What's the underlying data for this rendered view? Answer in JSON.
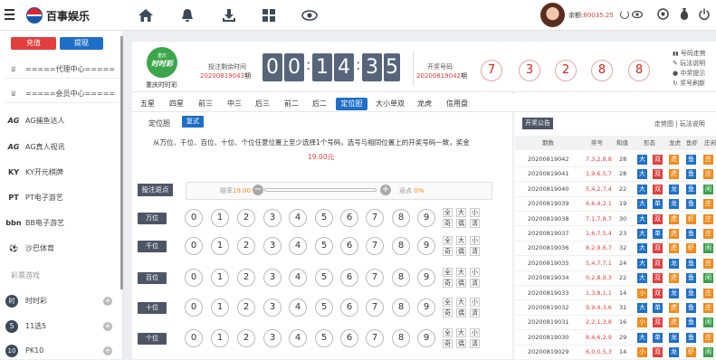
{
  "brand": {
    "name": "百事娱乐"
  },
  "topbar": {
    "balance_label": "余额:",
    "balance": "80035.25",
    "nav_icons": [
      "home-icon",
      "bell-icon",
      "download-icon",
      "grid-icon",
      "eye-icon"
    ]
  },
  "sidebar": {
    "deposit": "充值",
    "withdraw": "提现",
    "agent": "=====代理中心=====",
    "member": "=====会员中心=====",
    "items": [
      {
        "icon": "AG",
        "label": "AG捕鱼达人"
      },
      {
        "icon": "AG",
        "label": "AG真人视讯"
      },
      {
        "icon": "KY",
        "label": "KY开元棋牌"
      },
      {
        "icon": "PT",
        "label": "PT电子游艺"
      },
      {
        "icon": "bbn",
        "label": "BB电子游艺"
      },
      {
        "icon": "⚽",
        "label": "沙巴体育"
      }
    ],
    "section": "彩票游戏",
    "games": [
      {
        "icon": "时",
        "label": "时时彩"
      },
      {
        "icon": "5",
        "label": "11选5"
      },
      {
        "icon": "10",
        "label": "PK10"
      }
    ]
  },
  "lottery": {
    "logo_top": "重庆",
    "logo_main": "时时彩",
    "name": "重庆时时彩",
    "countdown_label": "投注剩余时间",
    "current_period": "20200819043",
    "period_suffix": "期",
    "countdown": [
      "0",
      "0",
      "1",
      "4",
      "3",
      "5"
    ],
    "draw_label": "开奖号码",
    "draw_period": "20200819042",
    "draw_numbers": [
      "7",
      "3",
      "2",
      "8",
      "8"
    ],
    "links": [
      "号码走势",
      "玩法说明",
      "中奖提示",
      "奖号刷新"
    ]
  },
  "tabs": [
    "五星",
    "四星",
    "前三",
    "中三",
    "后三",
    "前二",
    "后二",
    "定位胆",
    "大小单双",
    "龙虎",
    "信用盘"
  ],
  "active_tab": "定位胆",
  "subtabs": [
    "定位胆",
    "复式"
  ],
  "description": "从万位、千位、百位、十位、个位任意位置上至少选择1个号码，选号与相同位置上的开奖号码一致，奖金",
  "prize": "19.00元",
  "rebate": {
    "button": "投注返点",
    "odds_label": "赔率",
    "odds": "19.00",
    "rebate_label": "返点",
    "rebate": "0%"
  },
  "positions": [
    "万位",
    "千位",
    "百位",
    "十位",
    "个位"
  ],
  "numbers": [
    "0",
    "1",
    "2",
    "3",
    "4",
    "5",
    "6",
    "7",
    "8",
    "9"
  ],
  "quick": [
    "全",
    "大",
    "小",
    "奇",
    "偶",
    "清"
  ],
  "results": {
    "title": "开奖公告",
    "links": "走势图 | 玩法说明",
    "headers": [
      "期数",
      "奖号",
      "和值",
      "形态",
      "龙虎",
      "鱼虾",
      "庄闲"
    ],
    "rows": [
      {
        "p": "20200819042",
        "n": "7,3,2,8,8",
        "s": "28",
        "t": [
          "大",
          "双",
          "虎",
          "鱼",
          "庄"
        ]
      },
      {
        "p": "20200819041",
        "n": "1,9,6,5,7",
        "s": "28",
        "t": [
          "大",
          "双",
          "虎",
          "鱼",
          "庄"
        ]
      },
      {
        "p": "20200819040",
        "n": "5,4,2,7,4",
        "s": "22",
        "t": [
          "大",
          "双",
          "龙",
          "鱼",
          "闲"
        ]
      },
      {
        "p": "20200819039",
        "n": "6,6,4,2,1",
        "s": "19",
        "t": [
          "大",
          "单",
          "龙",
          "鱼",
          "庄"
        ]
      },
      {
        "p": "20200819038",
        "n": "7,1,7,8,7",
        "s": "30",
        "t": [
          "大",
          "双",
          "虎",
          "虾",
          "庄"
        ]
      },
      {
        "p": "20200819037",
        "n": "1,6,7,5,4",
        "s": "23",
        "t": [
          "大",
          "单",
          "虎",
          "鱼",
          "庄"
        ]
      },
      {
        "p": "20200819036",
        "n": "8,2,9,6,7",
        "s": "32",
        "t": [
          "大",
          "双",
          "虎",
          "虾",
          "闲"
        ]
      },
      {
        "p": "20200819035",
        "n": "5,4,7,7,1",
        "s": "24",
        "t": [
          "大",
          "双",
          "龙",
          "鱼",
          "庄"
        ]
      },
      {
        "p": "20200819034",
        "n": "0,2,8,9,3",
        "s": "22",
        "t": [
          "大",
          "双",
          "虎",
          "鱼",
          "闲"
        ]
      },
      {
        "p": "20200819033",
        "n": "1,3,8,1,1",
        "s": "14",
        "t": [
          "小",
          "双",
          "龙",
          "鱼",
          "庄"
        ]
      },
      {
        "p": "20200819032",
        "n": "9,9,4,3,6",
        "s": "31",
        "t": [
          "大",
          "单",
          "虎",
          "鱼",
          "庄"
        ]
      },
      {
        "p": "20200819031",
        "n": "2,2,1,3,8",
        "s": "16",
        "t": [
          "小",
          "双",
          "虎",
          "鱼",
          "闲"
        ]
      },
      {
        "p": "20200819030",
        "n": "8,4,6,2,9",
        "s": "29",
        "t": [
          "大",
          "单",
          "龙",
          "鱼",
          "庄"
        ]
      },
      {
        "p": "20200819029",
        "n": "6,0,0,5,3",
        "s": "14",
        "t": [
          "小",
          "双",
          "龙",
          "虾",
          "闲"
        ]
      }
    ]
  },
  "colors": {
    "blue": "#1f6fc7",
    "red": "#e33e3e",
    "orange": "#ef8b1d",
    "green": "#3aa04a",
    "slate": "#56657a"
  }
}
